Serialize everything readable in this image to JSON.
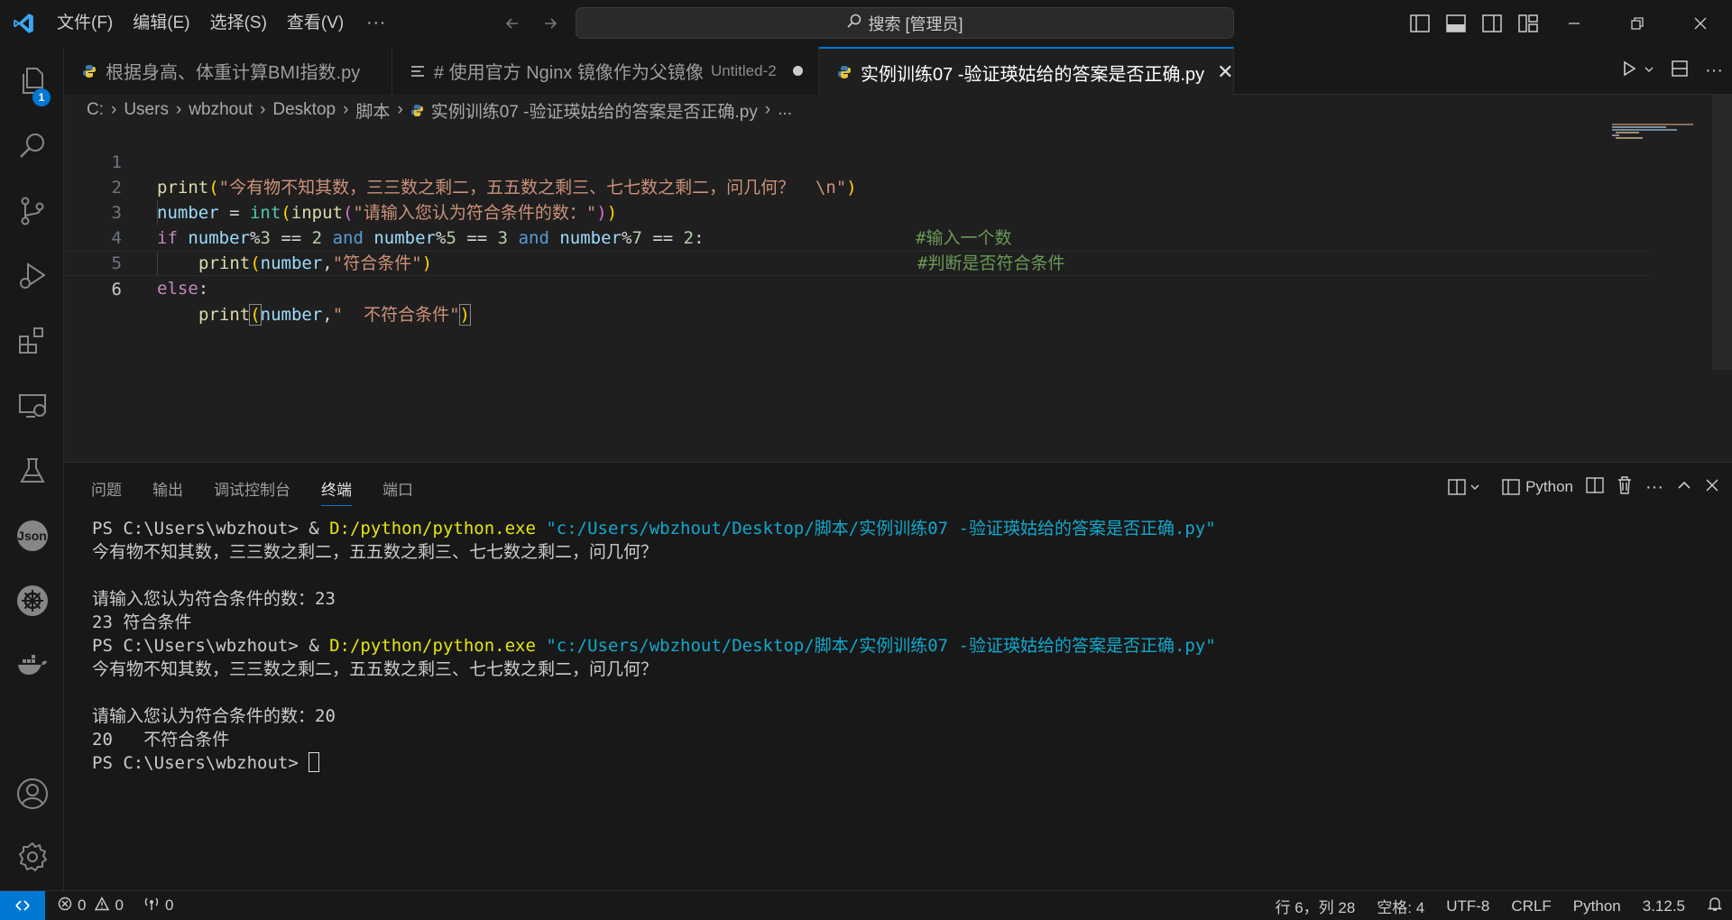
{
  "menu": {
    "items": [
      "文件(F)",
      "编辑(E)",
      "选择(S)",
      "查看(V)"
    ],
    "more": "···"
  },
  "search": {
    "text": "搜索 [管理员]"
  },
  "activity": {
    "explorer_badge": "1",
    "json_label": "Json"
  },
  "tabs": [
    {
      "label": "根据身高、体重计算BMI指数.py"
    },
    {
      "label": "# 使用官方 Nginx 镜像作为父镜像",
      "sub": "Untitled-2"
    },
    {
      "label": "实例训练07 -验证瑛姑给的答案是否正确.py"
    }
  ],
  "breadcrumb": {
    "parts": [
      "C:",
      "Users",
      "wbzhout",
      "Desktop",
      "脚本",
      "实例训练07 -验证瑛姑给的答案是否正确.py",
      "..."
    ]
  },
  "code": {
    "line_numbers": [
      "1",
      "2",
      "3",
      "4",
      "5",
      "6"
    ],
    "l1": {
      "fn": "print",
      "p1": "(",
      "str": "\"今有物不知其数，三三数之剩二，五五数之剩三、七七数之剩二，问几何？  \\n\"",
      "p2": ")"
    },
    "l2": {
      "var": "number",
      "op": " = ",
      "bi": "int",
      "p1": "(",
      "fn": "input",
      "p2": "(",
      "str": "\"请输入您认为符合条件的数：\"",
      "p3": ")",
      "p4": ")",
      "cmt": "#输入一个数"
    },
    "l3": {
      "kw": "if",
      "v1": "number",
      "o1": "%",
      "n1": "3",
      "o2": " == ",
      "n2": "2",
      "and1": "and",
      "v2": "number",
      "o3": "%",
      "n3": "5",
      "o4": " == ",
      "n4": "3",
      "and2": "and",
      "v3": "number",
      "o5": "%",
      "n5": "7",
      "o6": " == ",
      "n6": "2",
      "colon": ":",
      "cmt": "#判断是否符合条件"
    },
    "l4": {
      "fn": "print",
      "p1": "(",
      "var": "number",
      "comma": ",",
      "str": "\"符合条件\"",
      "p2": ")"
    },
    "l5": {
      "kw": "else",
      "colon": ":"
    },
    "l6": {
      "fn": "print",
      "p1": "(",
      "var": "number",
      "comma": ",",
      "str": "\"  不符合条件\"",
      "p2": ")"
    }
  },
  "panel": {
    "tabs": [
      "问题",
      "输出",
      "调试控制台",
      "终端",
      "端口"
    ],
    "active_tab": "终端",
    "terminal_profile": "Python"
  },
  "terminal": {
    "prompt": "PS C:\\Users\\wbzhout> ",
    "amp": "& ",
    "exe": "D:/python/python.exe",
    "script": "\"c:/Users/wbzhout/Desktop/脚本/实例训练07 -验证瑛姑给的答案是否正确.py\"",
    "question": "今有物不知其数，三三数之剩二，五五数之剩三、七七数之剩二，问几何？",
    "input_prompt_1": "请输入您认为符合条件的数：23",
    "result_1": "23 符合条件",
    "input_prompt_2": "请输入您认为符合条件的数：20",
    "result_2": "20   不符合条件",
    "final_prompt": "PS C:\\Users\\wbzhout> "
  },
  "status": {
    "errors": "0",
    "warnings": "0",
    "ports": "0",
    "position": "行 6，列 28",
    "spaces": "空格: 4",
    "encoding": "UTF-8",
    "eol": "CRLF",
    "language": "Python",
    "version": "3.12.5"
  },
  "colors": {
    "accent": "#0078d4",
    "background": "#1f1f1f",
    "chrome": "#181818",
    "terminal_yellow": "#e5e510",
    "terminal_cyan": "#11a8cd"
  }
}
